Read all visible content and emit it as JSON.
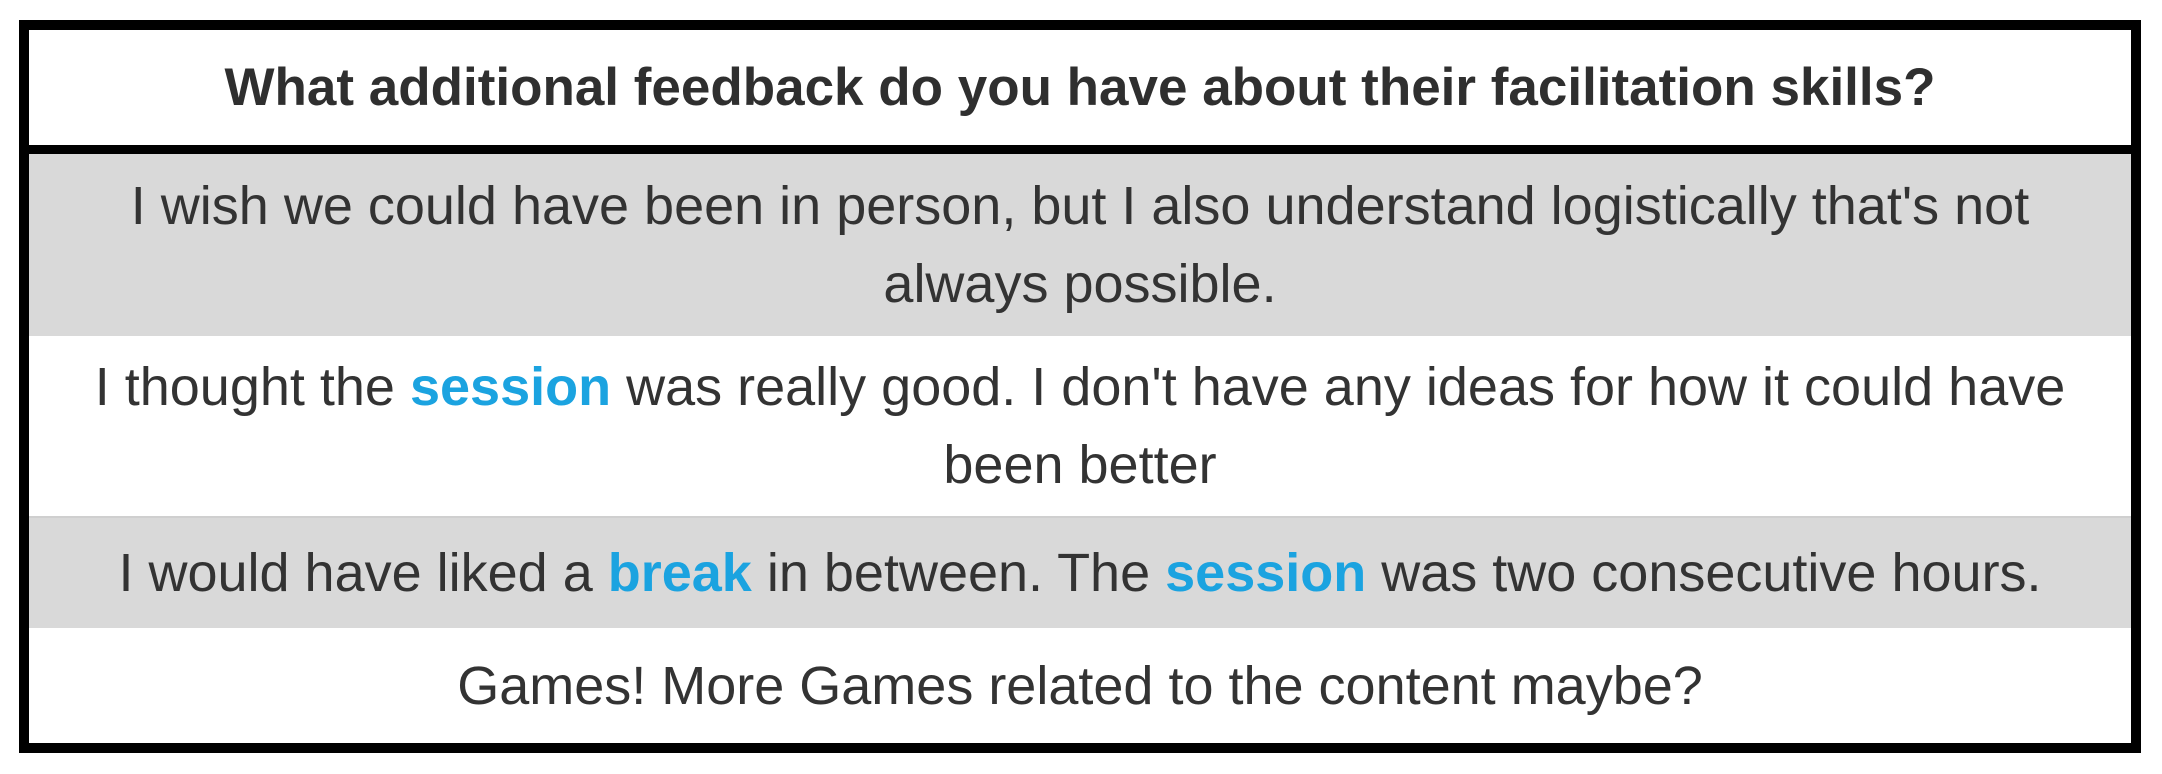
{
  "colors": {
    "border": "#000000",
    "shaded_row": "#d9d9d9",
    "text": "#333333",
    "keyword": "#1ba3e0"
  },
  "table": {
    "header": "What additional feedback do you have about their facilitation skills?",
    "rows": [
      {
        "shaded": true,
        "segments": [
          {
            "text": "I wish we could have been in person, but I also understand logistically that's not always possible.",
            "keyword": false
          }
        ]
      },
      {
        "shaded": false,
        "segments": [
          {
            "text": "I thought the ",
            "keyword": false
          },
          {
            "text": "session",
            "keyword": true
          },
          {
            "text": " was really good. I don't have any ideas for how it could have been better",
            "keyword": false
          }
        ]
      },
      {
        "shaded": true,
        "segments": [
          {
            "text": "I would have liked a ",
            "keyword": false
          },
          {
            "text": "break",
            "keyword": true
          },
          {
            "text": " in between. The ",
            "keyword": false
          },
          {
            "text": "session",
            "keyword": true
          },
          {
            "text": " was two consecutive hours.",
            "keyword": false
          }
        ]
      },
      {
        "shaded": false,
        "segments": [
          {
            "text": "Games! More Games related to the content maybe?",
            "keyword": false
          }
        ]
      }
    ]
  }
}
